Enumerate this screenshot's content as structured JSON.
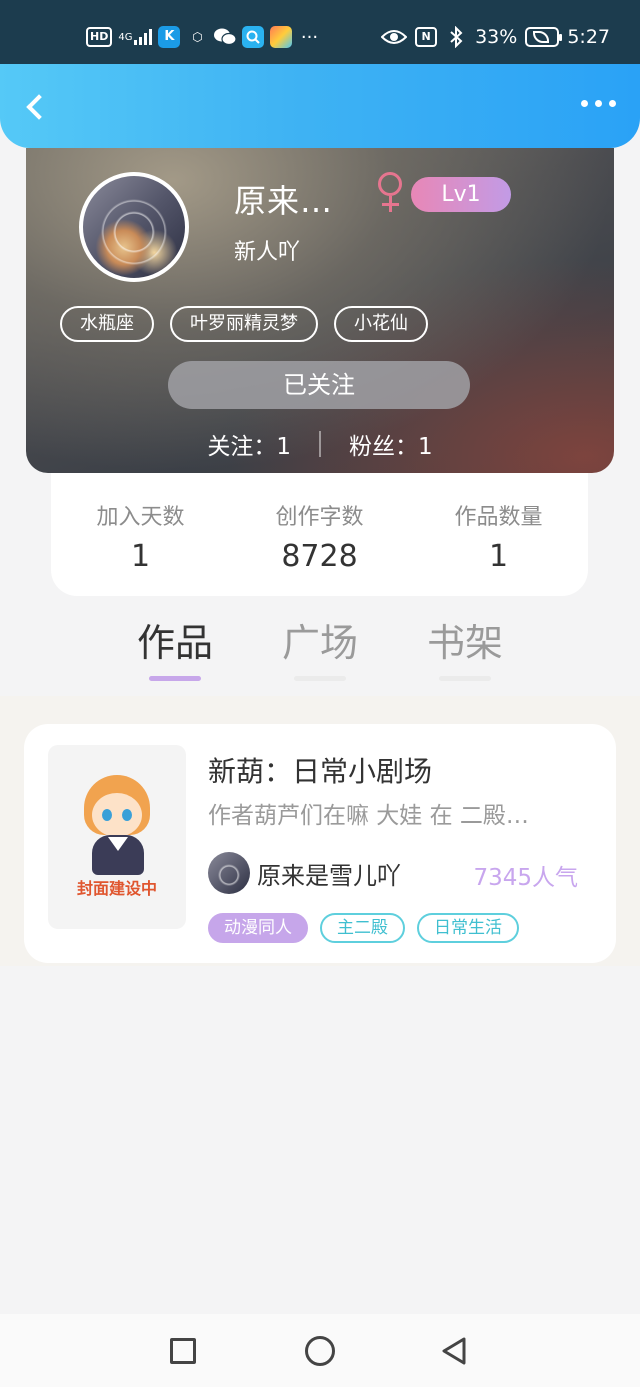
{
  "status_bar": {
    "network": "HD",
    "signal": "4G",
    "battery_percent": "33%",
    "time": "5:27",
    "icons": [
      "hd-icon",
      "signal-icon",
      "app-k-icon",
      "hexagon-icon",
      "wechat-icon",
      "search-app-icon",
      "store-app-icon",
      "more-dots-icon",
      "eye-icon",
      "nfc-icon",
      "bluetooth-icon",
      "battery-icon"
    ]
  },
  "profile": {
    "username": "原来…",
    "level": "Lv1",
    "subtitle": "新人吖",
    "tags": [
      "水瓶座",
      "叶罗丽精灵梦",
      "小花仙"
    ],
    "follow_button": "已关注",
    "following": "关注：1",
    "followers": "粉丝：1",
    "gender_color": "#e6758f"
  },
  "stats": [
    {
      "label": "加入天数",
      "value": "1"
    },
    {
      "label": "创作字数",
      "value": "8728"
    },
    {
      "label": "作品数量",
      "value": "1"
    }
  ],
  "tabs": [
    "作品",
    "广场",
    "书架"
  ],
  "work": {
    "cover_text": "封面建设中",
    "title": "新葫：日常小剧场",
    "description": "作者葫芦们在嘛 大娃 在 二殿…",
    "author": "原来是雪儿吖",
    "popularity": "7345人气",
    "tags": [
      "动漫同人",
      "主二殿",
      "日常生活"
    ]
  },
  "colors": {
    "header_gradient_start": "#55c9f7",
    "header_gradient_end": "#2aa2f6",
    "accent_purple": "#c6a6ea",
    "tag_teal": "#5ecfdd"
  }
}
